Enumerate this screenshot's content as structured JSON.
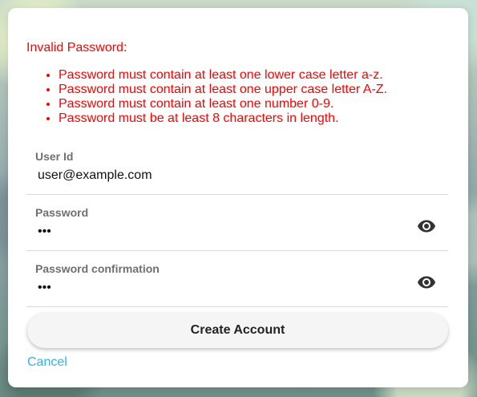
{
  "error": {
    "title": "Invalid Password:",
    "color": "#ff0000",
    "items": [
      "Password must contain at least one lower case letter a-z.",
      "Password must contain at least one upper case letter A-Z.",
      "Password must contain at least one number 0-9.",
      "Password must be at least 8 characters in length."
    ]
  },
  "form": {
    "user_id": {
      "label": "User Id",
      "value": "user@example.com"
    },
    "password": {
      "label": "Password",
      "value": "•••",
      "toggle_icon": "eye-icon"
    },
    "password_confirmation": {
      "label": "Password confirmation",
      "value": "•••",
      "toggle_icon": "eye-icon"
    }
  },
  "actions": {
    "create_label": "Create Account",
    "cancel_label": "Cancel",
    "link_color": "#29b6f6"
  }
}
